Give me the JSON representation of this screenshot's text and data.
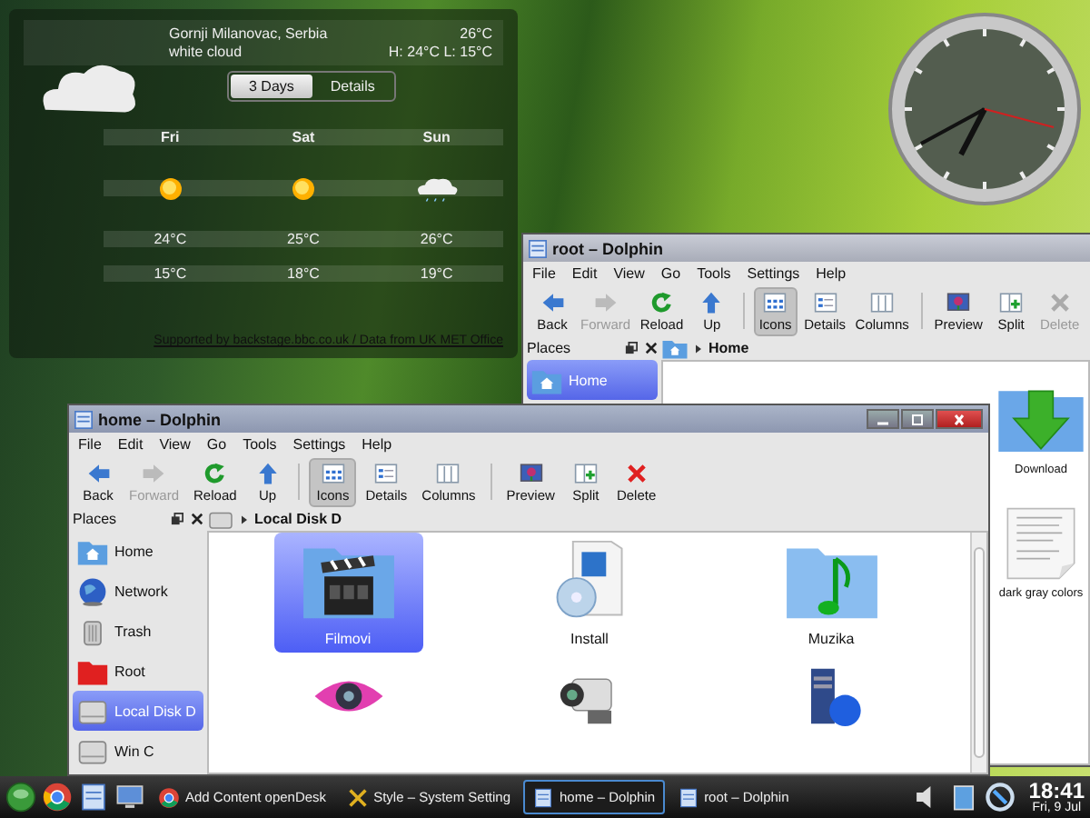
{
  "weather": {
    "location": "Gornji Milanovac, Serbia",
    "condition": "white cloud",
    "temperature": "26°C",
    "high_low": "H: 24°C L: 15°C",
    "tabs": [
      {
        "label": "3 Days",
        "selected": true
      },
      {
        "label": "Details",
        "selected": false
      }
    ],
    "days": [
      {
        "name": "Fri",
        "kind": "sun",
        "high": "24°C",
        "low": "15°C"
      },
      {
        "name": "Sat",
        "kind": "sun",
        "high": "25°C",
        "low": "18°C"
      },
      {
        "name": "Sun",
        "kind": "cloud-rain",
        "high": "26°C",
        "low": "19°C"
      }
    ],
    "footer": "Supported by backstage.bbc.co.uk / Data from UK MET Office"
  },
  "windows": [
    {
      "title": "root – Dolphin",
      "active": false,
      "menu": [
        "File",
        "Edit",
        "View",
        "Go",
        "Tools",
        "Settings",
        "Help"
      ],
      "toolbar": [
        {
          "label": "Back",
          "kind": "back",
          "selected": false,
          "disabled": false
        },
        {
          "label": "Forward",
          "kind": "forward",
          "selected": false,
          "disabled": true
        },
        {
          "label": "Reload",
          "kind": "reload",
          "selected": false,
          "disabled": false
        },
        {
          "label": "Up",
          "kind": "up",
          "selected": false,
          "disabled": false
        },
        {
          "label": "Icons",
          "kind": "icons",
          "selected": true,
          "disabled": false
        },
        {
          "label": "Details",
          "kind": "details",
          "selected": false,
          "disabled": false
        },
        {
          "label": "Columns",
          "kind": "columns",
          "selected": false,
          "disabled": false
        },
        {
          "label": "Preview",
          "kind": "preview",
          "selected": false,
          "disabled": false
        },
        {
          "label": "Split",
          "kind": "split",
          "selected": false,
          "disabled": false
        },
        {
          "label": "Delete",
          "kind": "delete",
          "selected": false,
          "disabled": true
        }
      ],
      "places_label": "Places",
      "places": [
        {
          "label": "Home",
          "kind": "home",
          "selected": true
        }
      ],
      "breadcrumb": {
        "kind": "home",
        "label": "Home"
      },
      "files": [
        {
          "name": "Download",
          "kind": "folder-download",
          "selected": false
        },
        {
          "name": "dark gray colors",
          "kind": "document",
          "selected": false
        }
      ]
    },
    {
      "title": "home – Dolphin",
      "active": true,
      "menu": [
        "File",
        "Edit",
        "View",
        "Go",
        "Tools",
        "Settings",
        "Help"
      ],
      "toolbar": [
        {
          "label": "Back",
          "kind": "back",
          "selected": false,
          "disabled": false
        },
        {
          "label": "Forward",
          "kind": "forward",
          "selected": false,
          "disabled": true
        },
        {
          "label": "Reload",
          "kind": "reload",
          "selected": false,
          "disabled": false
        },
        {
          "label": "Up",
          "kind": "up",
          "selected": false,
          "disabled": false
        },
        {
          "label": "Icons",
          "kind": "icons",
          "selected": true,
          "disabled": false
        },
        {
          "label": "Details",
          "kind": "details",
          "selected": false,
          "disabled": false
        },
        {
          "label": "Columns",
          "kind": "columns",
          "selected": false,
          "disabled": false
        },
        {
          "label": "Preview",
          "kind": "preview",
          "selected": false,
          "disabled": false
        },
        {
          "label": "Split",
          "kind": "split",
          "selected": false,
          "disabled": false
        },
        {
          "label": "Delete",
          "kind": "delete",
          "selected": false,
          "disabled": false
        }
      ],
      "places_label": "Places",
      "places": [
        {
          "label": "Home",
          "kind": "home",
          "selected": false
        },
        {
          "label": "Network",
          "kind": "network",
          "selected": false
        },
        {
          "label": "Trash",
          "kind": "trash",
          "selected": false
        },
        {
          "label": "Root",
          "kind": "root",
          "selected": false
        },
        {
          "label": "Local Disk D",
          "kind": "disk",
          "selected": true
        },
        {
          "label": "Win C",
          "kind": "disk",
          "selected": false
        }
      ],
      "breadcrumb": {
        "kind": "disk",
        "label": "Local Disk D"
      },
      "files": [
        {
          "name": "Filmovi",
          "kind": "folder-film",
          "selected": true
        },
        {
          "name": "Install",
          "kind": "package",
          "selected": false
        },
        {
          "name": "Muzika",
          "kind": "folder-music",
          "selected": false
        },
        {
          "kind": "eye",
          "selected": false
        },
        {
          "kind": "camera",
          "selected": false
        },
        {
          "kind": "computer",
          "selected": false
        }
      ]
    }
  ],
  "taskbar": {
    "tasks": [
      {
        "label": "Add Content openDesk",
        "kind": "browser",
        "selected": false
      },
      {
        "label": "Style – System Setting",
        "kind": "tools",
        "selected": false
      },
      {
        "label": "home – Dolphin",
        "kind": "dolphin",
        "selected": true
      },
      {
        "label": "root – Dolphin",
        "kind": "dolphin",
        "selected": false
      }
    ],
    "time": "18:41",
    "date": "Fri, 9 Jul"
  }
}
